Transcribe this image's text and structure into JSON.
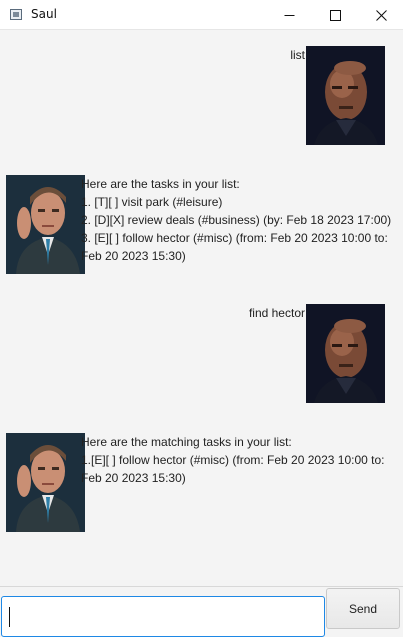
{
  "window": {
    "title": "Saul"
  },
  "messages": [
    {
      "role": "user",
      "text": "list"
    },
    {
      "role": "bot",
      "text": "Here are the tasks in your list:\n1. [T][ ] visit park (#leisure)\n2. [D][X] review deals (#business) (by: Feb 18 2023 17:00)\n3. [E][ ] follow hector (#misc) (from: Feb 20 2023 10:00 to:\nFeb 20 2023 15:30)"
    },
    {
      "role": "user",
      "text": "find hector"
    },
    {
      "role": "bot",
      "text": "Here are the matching tasks in your list:\n1.[E][ ] follow hector (#misc) (from: Feb 20 2023 10:00 to:\nFeb 20 2023 15:30)"
    }
  ],
  "avatars": {
    "user": "user-avatar",
    "bot": "saul-avatar"
  },
  "input": {
    "value": "",
    "placeholder": ""
  },
  "send_button": {
    "label": "Send"
  },
  "colors": {
    "input_focus_border": "#1e88e5",
    "background": "#f4f4f4"
  }
}
